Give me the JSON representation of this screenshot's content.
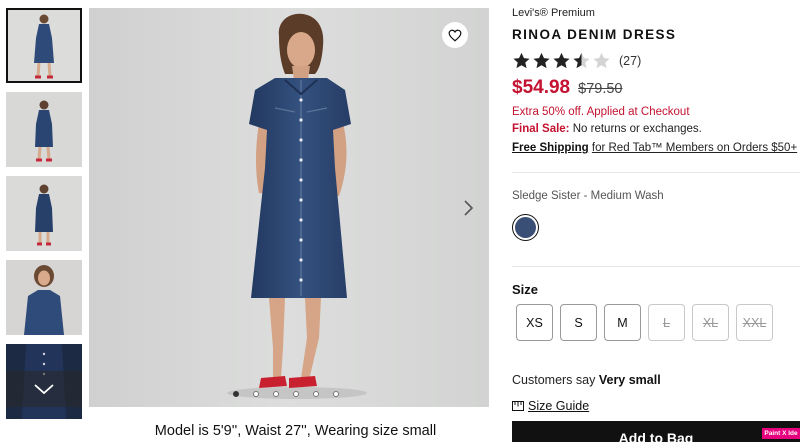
{
  "gallery": {
    "thumbnail_count": 5,
    "active_thumbnail": 0,
    "dots_count": 6,
    "active_dot": 0,
    "caption": "Model is 5'9'', Waist 27'', Wearing size small"
  },
  "product": {
    "brand": "Levi's® Premium",
    "name": "RINOA DENIM DRESS",
    "rating": 3.5,
    "rating_max": 5,
    "review_count": "(27)",
    "price_now": "$54.98",
    "price_was": "$79.50",
    "promo": "Extra 50% off. Applied at Checkout",
    "final_sale_label": "Final Sale:",
    "final_sale_text": "No returns or exchanges.",
    "shipping_bold": "Free Shipping",
    "shipping_text": "for Red Tab™ Members on Orders $50+"
  },
  "color": {
    "label": "Sledge Sister - Medium Wash",
    "swatch_color": "#3a4f76"
  },
  "size": {
    "label": "Size",
    "options": [
      {
        "label": "XS",
        "available": true
      },
      {
        "label": "S",
        "available": true
      },
      {
        "label": "M",
        "available": true
      },
      {
        "label": "L",
        "available": false
      },
      {
        "label": "XL",
        "available": false
      },
      {
        "label": "XXL",
        "available": false
      }
    ],
    "fit_prefix": "Customers say",
    "fit_value": "Very small",
    "guide_label": "Size Guide"
  },
  "actions": {
    "add_to_bag": "Add to Bag",
    "badge": "Paint X Ide"
  },
  "colors": {
    "sale_red": "#c41230",
    "denim": "#2e4a78",
    "background": "#d9dad9"
  }
}
